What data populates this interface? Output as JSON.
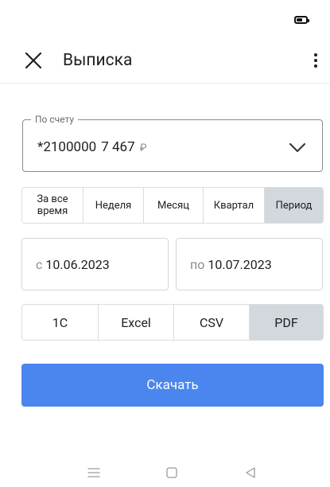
{
  "app_bar": {
    "title": "Выписка",
    "close_icon": "close-icon",
    "more_icon": "more-vertical-icon"
  },
  "status_bar": {
    "battery_icon": "battery-icon",
    "battery_level": 0.6
  },
  "account": {
    "legend": "По счету",
    "number": "*2100000",
    "balance": "7 467",
    "currency": "₽",
    "chevron_icon": "chevron-down-icon"
  },
  "periods": [
    {
      "label": "За все время",
      "selected": false
    },
    {
      "label": "Неделя",
      "selected": false
    },
    {
      "label": "Месяц",
      "selected": false
    },
    {
      "label": "Квартал",
      "selected": false
    },
    {
      "label": "Период",
      "selected": true
    }
  ],
  "date_range": {
    "from_prefix": "с",
    "from_value": "10.06.2023",
    "to_prefix": "по",
    "to_value": "10.07.2023"
  },
  "formats": [
    {
      "label": "1С",
      "selected": false
    },
    {
      "label": "Excel",
      "selected": false
    },
    {
      "label": "CSV",
      "selected": false
    },
    {
      "label": "PDF",
      "selected": true
    }
  ],
  "download_label": "Скачать",
  "nav_bar": {
    "menu_icon": "menu-icon",
    "home_icon": "home-square-icon",
    "back_icon": "back-triangle-icon"
  },
  "colors": {
    "accent": "#4a86ee",
    "selected_segment": "#d3d7de"
  }
}
